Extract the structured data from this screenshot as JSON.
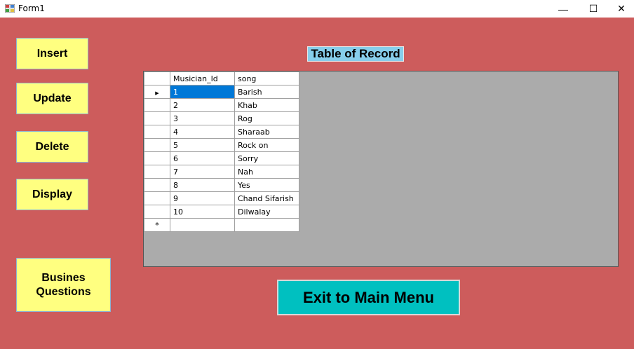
{
  "window": {
    "title": "Form1",
    "minimize": "—",
    "maximize": "☐",
    "close": "✕"
  },
  "buttons": {
    "insert": "Insert",
    "update": "Update",
    "delete": "Delete",
    "display": "Display",
    "business_line1": "Busines",
    "business_line2": "Questions",
    "exit": "Exit to Main Menu"
  },
  "heading": "Table of Record",
  "table": {
    "columns": [
      "Musician_Id",
      "song"
    ],
    "rows": [
      [
        "1",
        "Barish"
      ],
      [
        "2",
        "Khab"
      ],
      [
        "3",
        "Rog"
      ],
      [
        "4",
        "Sharaab"
      ],
      [
        "5",
        "Rock on"
      ],
      [
        "6",
        "Sorry"
      ],
      [
        "7",
        "Nah"
      ],
      [
        "8",
        "Yes"
      ],
      [
        "9",
        "Chand Sifarish"
      ],
      [
        "10",
        "Dilwalay"
      ]
    ],
    "current_row_marker": "▶",
    "new_row_marker": "*"
  },
  "colors": {
    "form_bg": "#cd5c5c",
    "button_bg": "#ffff80",
    "heading_bg": "#87ceeb",
    "exit_bg": "#00c0c0",
    "selection": "#0078d7"
  }
}
